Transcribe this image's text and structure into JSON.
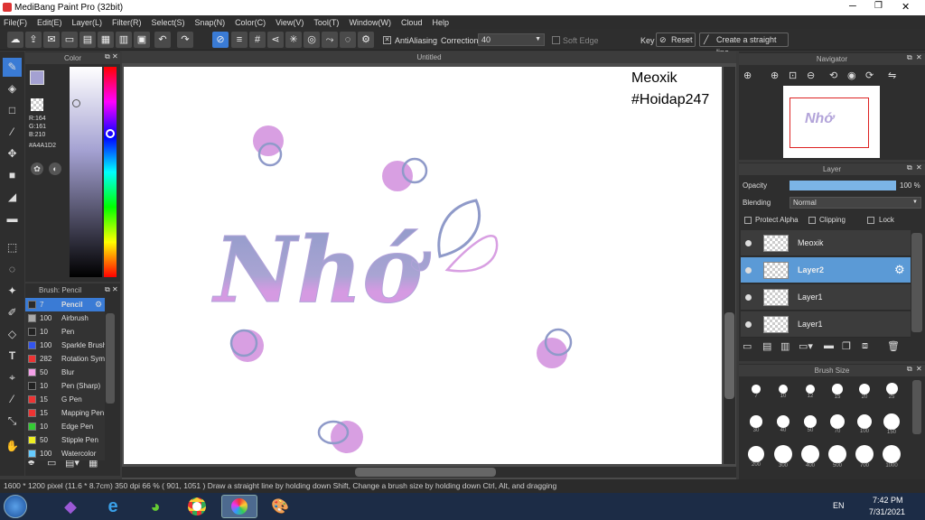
{
  "window": {
    "title": "MediBang Paint Pro (32bit)"
  },
  "menu": [
    "File(F)",
    "Edit(E)",
    "Layer(L)",
    "Filter(R)",
    "Select(S)",
    "Snap(N)",
    "Color(C)",
    "View(V)",
    "Tool(T)",
    "Window(W)",
    "Cloud",
    "Help"
  ],
  "toolbar": {
    "antialiasing": "AntiAliasing",
    "correction_label": "Correction",
    "correction_value": "40",
    "soft_edge": "Soft Edge",
    "key_label": "Key",
    "reset": "Reset",
    "straight_line": "Create a straight line"
  },
  "canvas": {
    "tab": "Untitled",
    "watermark1": "Meoxik",
    "watermark2": "#Hoidap247",
    "art_text": "Nhớ"
  },
  "color_panel": {
    "title": "Color",
    "r": "R:164",
    "g": "G:161",
    "b": "B:210",
    "hex": "#A4A1D2",
    "fg": "#A4A1D2"
  },
  "brush_panel": {
    "title": "Brush: Pencil",
    "brushes": [
      {
        "size": "7",
        "name": "Pencil",
        "color": "#2b2b2b",
        "selected": true
      },
      {
        "size": "100",
        "name": "Airbrush",
        "color": "#aaaaaa"
      },
      {
        "size": "10",
        "name": "Pen",
        "color": "#222222"
      },
      {
        "size": "100",
        "name": "Sparkle Brush",
        "color": "#3355ee"
      },
      {
        "size": "282",
        "name": "Rotation Sym",
        "color": "#ee3333"
      },
      {
        "size": "50",
        "name": "Blur",
        "color": "#f4a0e8"
      },
      {
        "size": "10",
        "name": "Pen (Sharp)",
        "color": "#222222"
      },
      {
        "size": "15",
        "name": "G Pen",
        "color": "#ee3333"
      },
      {
        "size": "15",
        "name": "Mapping Pen",
        "color": "#ee3333"
      },
      {
        "size": "10",
        "name": "Edge Pen",
        "color": "#33cc33"
      },
      {
        "size": "50",
        "name": "Stipple Pen",
        "color": "#eeee22"
      },
      {
        "size": "100",
        "name": "Watercolor",
        "color": "#66ccff"
      }
    ]
  },
  "navigator": {
    "title": "Navigator"
  },
  "layer_panel": {
    "title": "Layer",
    "opacity_label": "Opacity",
    "opacity_value": "100 %",
    "opacity": 1.0,
    "blending_label": "Blending",
    "blending_value": "Normal",
    "protect_alpha": "Protect Alpha",
    "clipping": "Clipping",
    "lock": "Lock",
    "layers": [
      {
        "name": "Meoxik",
        "selected": false
      },
      {
        "name": "Layer2",
        "selected": true
      },
      {
        "name": "Layer1",
        "selected": false
      },
      {
        "name": "Layer1",
        "selected": false
      }
    ]
  },
  "brush_size": {
    "title": "Brush Size",
    "sizes": [
      "7",
      "10",
      "12",
      "15",
      "20",
      "25",
      "30",
      "40",
      "50",
      "70",
      "100",
      "150",
      "200",
      "300",
      "400",
      "500",
      "700",
      "1000"
    ]
  },
  "status": {
    "text": "1600 * 1200 pixel   (11.6 * 8.7cm)   350 dpi   66 %   ( 901, 1051 )   Draw a straight line by holding down Shift, Change a brush size by holding down Ctrl, Alt, and dragging"
  },
  "taskbar": {
    "lang": "EN",
    "time": "7:42 PM",
    "date": "7/31/2021"
  }
}
